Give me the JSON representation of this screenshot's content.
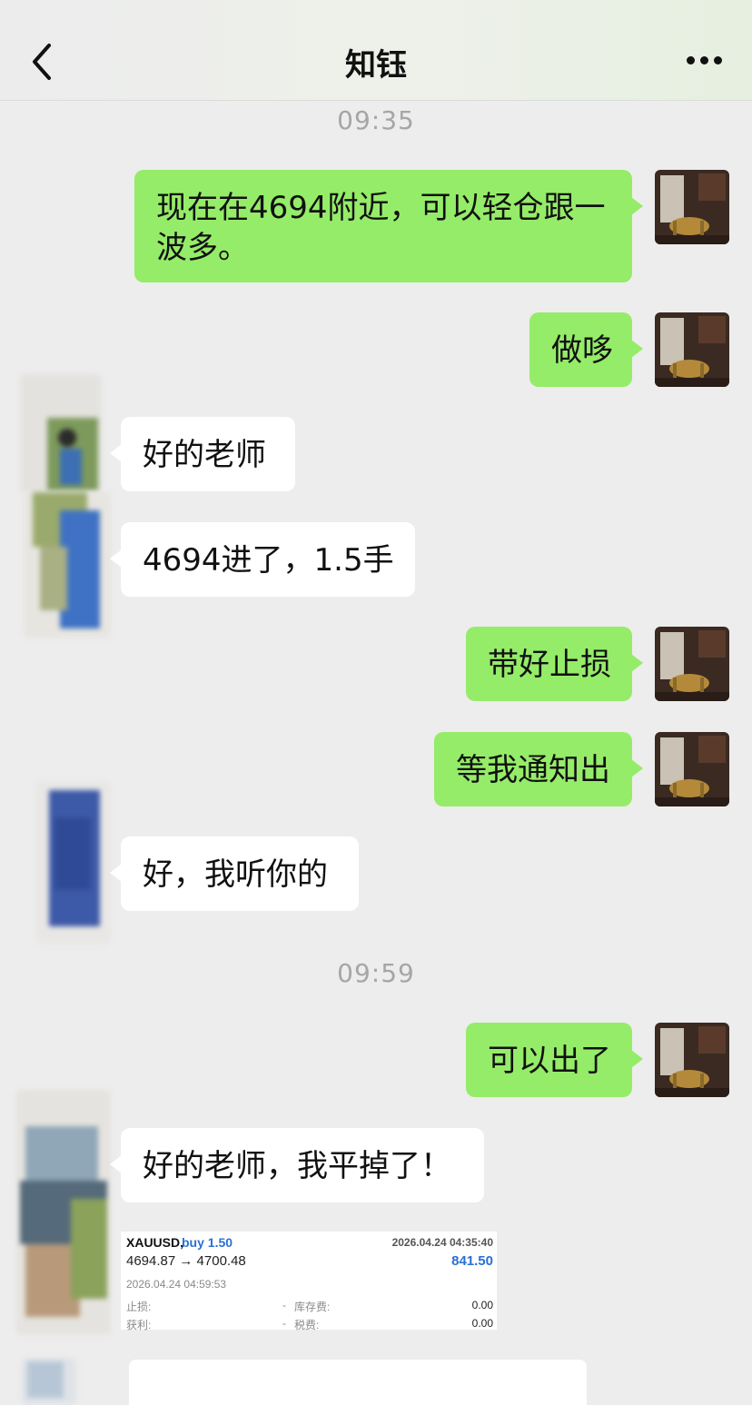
{
  "header": {
    "title": "知钰"
  },
  "timestamps": [
    "09:35",
    "09:59"
  ],
  "messages": [
    {
      "side": "out",
      "text": "现在在4694附近，可以轻仓跟一波多。"
    },
    {
      "side": "out",
      "text": "做哆"
    },
    {
      "side": "in",
      "text": "好的老师"
    },
    {
      "side": "in",
      "text": "4694进了，1.5手"
    },
    {
      "side": "out",
      "text": "带好止损"
    },
    {
      "side": "out",
      "text": "等我通知出"
    },
    {
      "side": "in",
      "text": "好，我听你的"
    },
    {
      "side": "out",
      "text": "可以出了"
    },
    {
      "side": "in",
      "text": "好的老师，我平掉了！"
    }
  ],
  "trade": {
    "symbol": "XAUUSD,",
    "action": "buy 1.50",
    "open_time": "2026.04.24 04:35:40",
    "prices": "4694.87 → 4700.48",
    "profit": "841.50",
    "close_time": "2026.04.24 04:59:53",
    "sl_label": "止损:",
    "sl_value": "-",
    "swap_label": "库存费:",
    "swap_value": "0.00",
    "tp_label": "获利:",
    "tp_value": "-",
    "tax_label": "税费:",
    "tax_value": "0.00"
  },
  "colors": {
    "outgoing_bubble": "#95ec69",
    "incoming_bubble": "#ffffff",
    "background": "#ededed",
    "trade_accent": "#2a6fd6"
  },
  "icons": [
    "back-arrow-icon",
    "more-dots-icon"
  ]
}
